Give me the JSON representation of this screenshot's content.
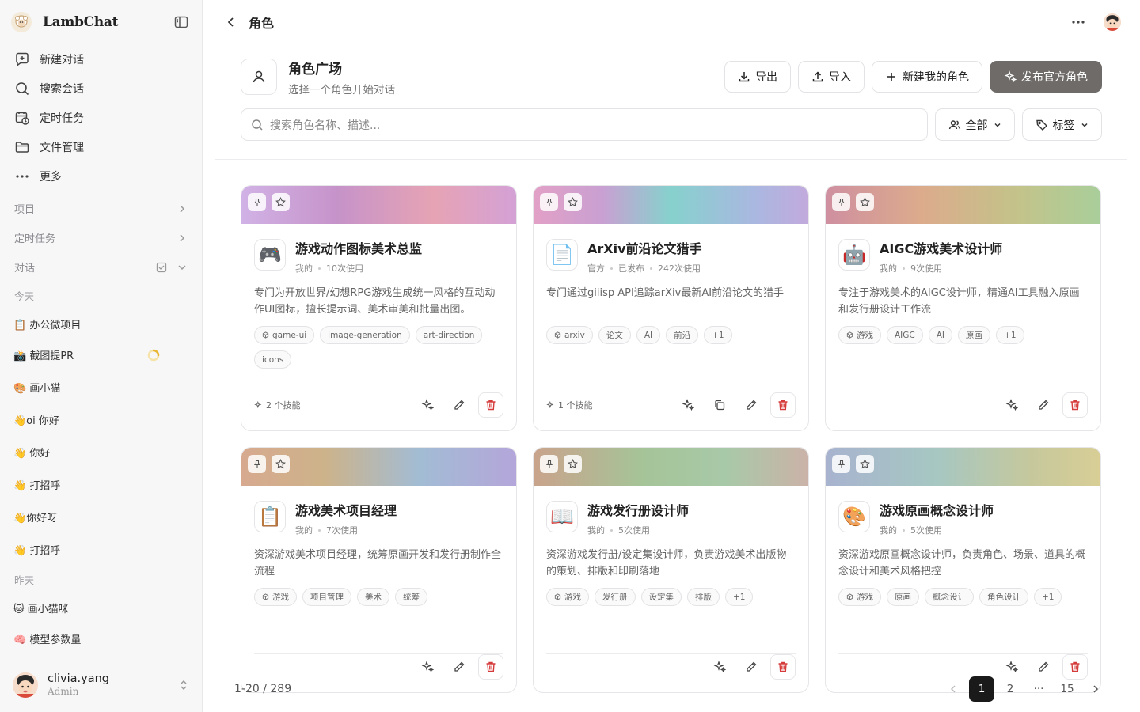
{
  "app": {
    "name": "LambChat"
  },
  "sidebar": {
    "nav": [
      {
        "label": "新建对话",
        "icon": "new-chat-icon"
      },
      {
        "label": "搜索会话",
        "icon": "search-icon"
      },
      {
        "label": "定时任务",
        "icon": "clock-calendar-icon"
      },
      {
        "label": "文件管理",
        "icon": "folder-icon"
      },
      {
        "label": "更多",
        "icon": "more-dots-icon"
      }
    ],
    "sections": {
      "projects": "项目",
      "scheduled": "定时任务",
      "conversations": "对话"
    },
    "groups": {
      "today": "今天",
      "yesterday": "昨天"
    },
    "today": [
      "📋 办公微项目",
      "📸 截图提PR",
      "🎨 画小猫",
      "👋oi 你好",
      "👋 你好",
      "👋 打招呼",
      "👋你好呀",
      "👋 打招呼"
    ],
    "yesterday": [
      "🐱 画小猫咪",
      "🧠 模型参数量"
    ],
    "user": {
      "name": "clivia.yang",
      "role": "Admin"
    }
  },
  "topbar": {
    "title": "角色"
  },
  "header": {
    "title": "角色广场",
    "subtitle": "选择一个角色开始对话"
  },
  "buttons": {
    "export": "导出",
    "import": "导入",
    "new_role": "新建我的角色",
    "publish": "发布官方角色"
  },
  "search": {
    "placeholder": "搜索角色名称、描述..."
  },
  "filters": {
    "all": "全部",
    "tags": "标签"
  },
  "cards": [
    {
      "name": "游戏动作图标美术总监",
      "meta": [
        "我的",
        "10次使用"
      ],
      "desc": "专门为开放世界/幻想RPG游戏生成统一风格的互动动作UI图标，擅长提示词、美术审美和批量出图。",
      "tags": [
        "game-ui",
        "image-generation",
        "art-direction",
        "icons"
      ],
      "skills": "2 个技能",
      "emoji": "🎮",
      "copy": false
    },
    {
      "name": "ArXiv前沿论文猎手",
      "meta": [
        "官方",
        "已发布",
        "242次使用"
      ],
      "desc": "专门通过giiisp API追踪arXiv最新AI前沿论文的猎手",
      "tags": [
        "arxiv",
        "论文",
        "AI",
        "前沿",
        "+1"
      ],
      "skills": "1 个技能",
      "emoji": "📄",
      "copy": true
    },
    {
      "name": "AIGC游戏美术设计师",
      "meta": [
        "我的",
        "9次使用"
      ],
      "desc": "专注于游戏美术的AIGC设计师，精通AI工具融入原画和发行册设计工作流",
      "tags": [
        "游戏",
        "AIGC",
        "AI",
        "原画",
        "+1"
      ],
      "skills": "",
      "emoji": "🤖",
      "copy": false
    },
    {
      "name": "游戏美术项目经理",
      "meta": [
        "我的",
        "7次使用"
      ],
      "desc": "资深游戏美术项目经理，统筹原画开发和发行册制作全流程",
      "tags": [
        "游戏",
        "项目管理",
        "美术",
        "统筹"
      ],
      "skills": "",
      "emoji": "📋",
      "copy": false
    },
    {
      "name": "游戏发行册设计师",
      "meta": [
        "我的",
        "5次使用"
      ],
      "desc": "资深游戏发行册/设定集设计师，负责游戏美术出版物的策划、排版和印刷落地",
      "tags": [
        "游戏",
        "发行册",
        "设定集",
        "排版",
        "+1"
      ],
      "skills": "",
      "emoji": "📖",
      "copy": false
    },
    {
      "name": "游戏原画概念设计师",
      "meta": [
        "我的",
        "5次使用"
      ],
      "desc": "资深游戏原画概念设计师，负责角色、场景、道具的概念设计和美术风格把控",
      "tags": [
        "游戏",
        "原画",
        "概念设计",
        "角色设计",
        "+1"
      ],
      "skills": "",
      "emoji": "🎨",
      "copy": false
    }
  ],
  "pagination": {
    "range": "1-20 / 289",
    "pages": [
      "1",
      "2",
      "···",
      "15"
    ],
    "current": "1"
  }
}
